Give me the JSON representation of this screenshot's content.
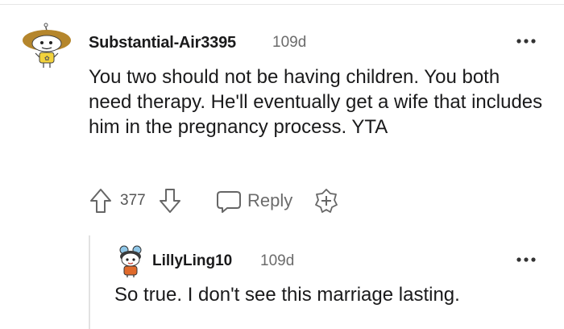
{
  "comment": {
    "username": "Substantial-Air3395",
    "time": "109d",
    "body": "You two should not be having children. You both need therapy. He'll eventually get a wife that includes him in the pregnancy process. YTA",
    "votes": "377",
    "reply_label": "Reply",
    "icons": [
      "avatar-icon",
      "more-options-icon",
      "upvote-icon",
      "downvote-icon",
      "reply-icon",
      "award-icon"
    ]
  },
  "reply_comment": {
    "username": "LillyLing10",
    "time": "109d",
    "body": "So true. I don't see this marriage lasting.",
    "icons": [
      "avatar-icon",
      "more-options-icon"
    ]
  },
  "colors": {
    "text": "#1a1a1b",
    "meta": "#6b6b6b",
    "divider": "#e2e2e2",
    "avatar_hair": "#b5862c",
    "avatar_shirt": "#f2d23c"
  }
}
